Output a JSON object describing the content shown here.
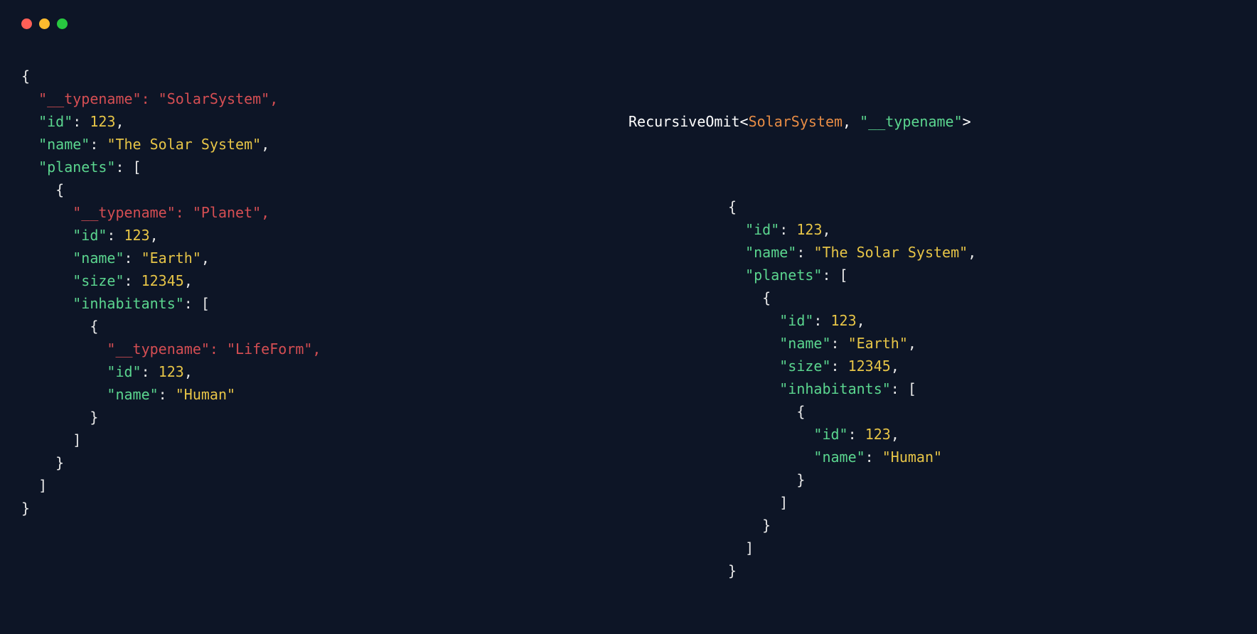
{
  "colors": {
    "background": "#0d1526",
    "text": "#e8e8e8",
    "key": "#5bd68f",
    "value": "#e7c547",
    "omitted": "#d54e53",
    "typeName": "#e78c45",
    "dotRed": "#ff5f57",
    "dotYellow": "#febc2e",
    "dotGreen": "#28c840"
  },
  "header": {
    "fn": "RecursiveOmit",
    "lt": "<",
    "typeName": "SolarSystem",
    "comma": ", ",
    "omitKey": "\"__typename\"",
    "gt": ">"
  },
  "left": [
    {
      "indent": 0,
      "segs": [
        {
          "t": "{",
          "c": "punc"
        }
      ]
    },
    {
      "indent": 1,
      "segs": [
        {
          "t": "\"__typename\": \"SolarSystem\",",
          "c": "omit"
        }
      ]
    },
    {
      "indent": 1,
      "segs": [
        {
          "t": "\"id\"",
          "c": "key"
        },
        {
          "t": ": ",
          "c": "punc"
        },
        {
          "t": "123",
          "c": "num"
        },
        {
          "t": ",",
          "c": "punc"
        }
      ]
    },
    {
      "indent": 1,
      "segs": [
        {
          "t": "\"name\"",
          "c": "key"
        },
        {
          "t": ": ",
          "c": "punc"
        },
        {
          "t": "\"The Solar System\"",
          "c": "str"
        },
        {
          "t": ",",
          "c": "punc"
        }
      ]
    },
    {
      "indent": 1,
      "segs": [
        {
          "t": "\"planets\"",
          "c": "key"
        },
        {
          "t": ": [",
          "c": "punc"
        }
      ]
    },
    {
      "indent": 2,
      "segs": [
        {
          "t": "{",
          "c": "punc"
        }
      ]
    },
    {
      "indent": 3,
      "segs": [
        {
          "t": "\"__typename\": \"Planet\",",
          "c": "omit"
        }
      ]
    },
    {
      "indent": 3,
      "segs": [
        {
          "t": "\"id\"",
          "c": "key"
        },
        {
          "t": ": ",
          "c": "punc"
        },
        {
          "t": "123",
          "c": "num"
        },
        {
          "t": ",",
          "c": "punc"
        }
      ]
    },
    {
      "indent": 3,
      "segs": [
        {
          "t": "\"name\"",
          "c": "key"
        },
        {
          "t": ": ",
          "c": "punc"
        },
        {
          "t": "\"Earth\"",
          "c": "str"
        },
        {
          "t": ",",
          "c": "punc"
        }
      ]
    },
    {
      "indent": 3,
      "segs": [
        {
          "t": "\"size\"",
          "c": "key"
        },
        {
          "t": ": ",
          "c": "punc"
        },
        {
          "t": "12345",
          "c": "num"
        },
        {
          "t": ",",
          "c": "punc"
        }
      ]
    },
    {
      "indent": 3,
      "segs": [
        {
          "t": "\"inhabitants\"",
          "c": "key"
        },
        {
          "t": ": [",
          "c": "punc"
        }
      ]
    },
    {
      "indent": 4,
      "segs": [
        {
          "t": "{",
          "c": "punc"
        }
      ]
    },
    {
      "indent": 5,
      "segs": [
        {
          "t": "\"__typename\": \"LifeForm\",",
          "c": "omit"
        }
      ]
    },
    {
      "indent": 5,
      "segs": [
        {
          "t": "\"id\"",
          "c": "key"
        },
        {
          "t": ": ",
          "c": "punc"
        },
        {
          "t": "123",
          "c": "num"
        },
        {
          "t": ",",
          "c": "punc"
        }
      ]
    },
    {
      "indent": 5,
      "segs": [
        {
          "t": "\"name\"",
          "c": "key"
        },
        {
          "t": ": ",
          "c": "punc"
        },
        {
          "t": "\"Human\"",
          "c": "str"
        }
      ]
    },
    {
      "indent": 4,
      "segs": [
        {
          "t": "}",
          "c": "punc"
        }
      ]
    },
    {
      "indent": 3,
      "segs": [
        {
          "t": "]",
          "c": "punc"
        }
      ]
    },
    {
      "indent": 2,
      "segs": [
        {
          "t": "}",
          "c": "punc"
        }
      ]
    },
    {
      "indent": 1,
      "segs": [
        {
          "t": "]",
          "c": "punc"
        }
      ]
    },
    {
      "indent": 0,
      "segs": [
        {
          "t": "}",
          "c": "punc"
        }
      ]
    }
  ],
  "right": [
    {
      "indent": 0,
      "segs": [
        {
          "t": "{",
          "c": "punc"
        }
      ]
    },
    {
      "indent": 1,
      "segs": [
        {
          "t": "\"id\"",
          "c": "key"
        },
        {
          "t": ": ",
          "c": "punc"
        },
        {
          "t": "123",
          "c": "num"
        },
        {
          "t": ",",
          "c": "punc"
        }
      ]
    },
    {
      "indent": 1,
      "segs": [
        {
          "t": "\"name\"",
          "c": "key"
        },
        {
          "t": ": ",
          "c": "punc"
        },
        {
          "t": "\"The Solar System\"",
          "c": "str"
        },
        {
          "t": ",",
          "c": "punc"
        }
      ]
    },
    {
      "indent": 1,
      "segs": [
        {
          "t": "\"planets\"",
          "c": "key"
        },
        {
          "t": ": [",
          "c": "punc"
        }
      ]
    },
    {
      "indent": 2,
      "segs": [
        {
          "t": "{",
          "c": "punc"
        }
      ]
    },
    {
      "indent": 3,
      "segs": [
        {
          "t": "\"id\"",
          "c": "key"
        },
        {
          "t": ": ",
          "c": "punc"
        },
        {
          "t": "123",
          "c": "num"
        },
        {
          "t": ",",
          "c": "punc"
        }
      ]
    },
    {
      "indent": 3,
      "segs": [
        {
          "t": "\"name\"",
          "c": "key"
        },
        {
          "t": ": ",
          "c": "punc"
        },
        {
          "t": "\"Earth\"",
          "c": "str"
        },
        {
          "t": ",",
          "c": "punc"
        }
      ]
    },
    {
      "indent": 3,
      "segs": [
        {
          "t": "\"size\"",
          "c": "key"
        },
        {
          "t": ": ",
          "c": "punc"
        },
        {
          "t": "12345",
          "c": "num"
        },
        {
          "t": ",",
          "c": "punc"
        }
      ]
    },
    {
      "indent": 3,
      "segs": [
        {
          "t": "\"inhabitants\"",
          "c": "key"
        },
        {
          "t": ": [",
          "c": "punc"
        }
      ]
    },
    {
      "indent": 4,
      "segs": [
        {
          "t": "{",
          "c": "punc"
        }
      ]
    },
    {
      "indent": 5,
      "segs": [
        {
          "t": "\"id\"",
          "c": "key"
        },
        {
          "t": ": ",
          "c": "punc"
        },
        {
          "t": "123",
          "c": "num"
        },
        {
          "t": ",",
          "c": "punc"
        }
      ]
    },
    {
      "indent": 5,
      "segs": [
        {
          "t": "\"name\"",
          "c": "key"
        },
        {
          "t": ": ",
          "c": "punc"
        },
        {
          "t": "\"Human\"",
          "c": "str"
        }
      ]
    },
    {
      "indent": 4,
      "segs": [
        {
          "t": "}",
          "c": "punc"
        }
      ]
    },
    {
      "indent": 3,
      "segs": [
        {
          "t": "]",
          "c": "punc"
        }
      ]
    },
    {
      "indent": 2,
      "segs": [
        {
          "t": "}",
          "c": "punc"
        }
      ]
    },
    {
      "indent": 1,
      "segs": [
        {
          "t": "]",
          "c": "punc"
        }
      ]
    },
    {
      "indent": 0,
      "segs": [
        {
          "t": "}",
          "c": "punc"
        }
      ]
    }
  ]
}
